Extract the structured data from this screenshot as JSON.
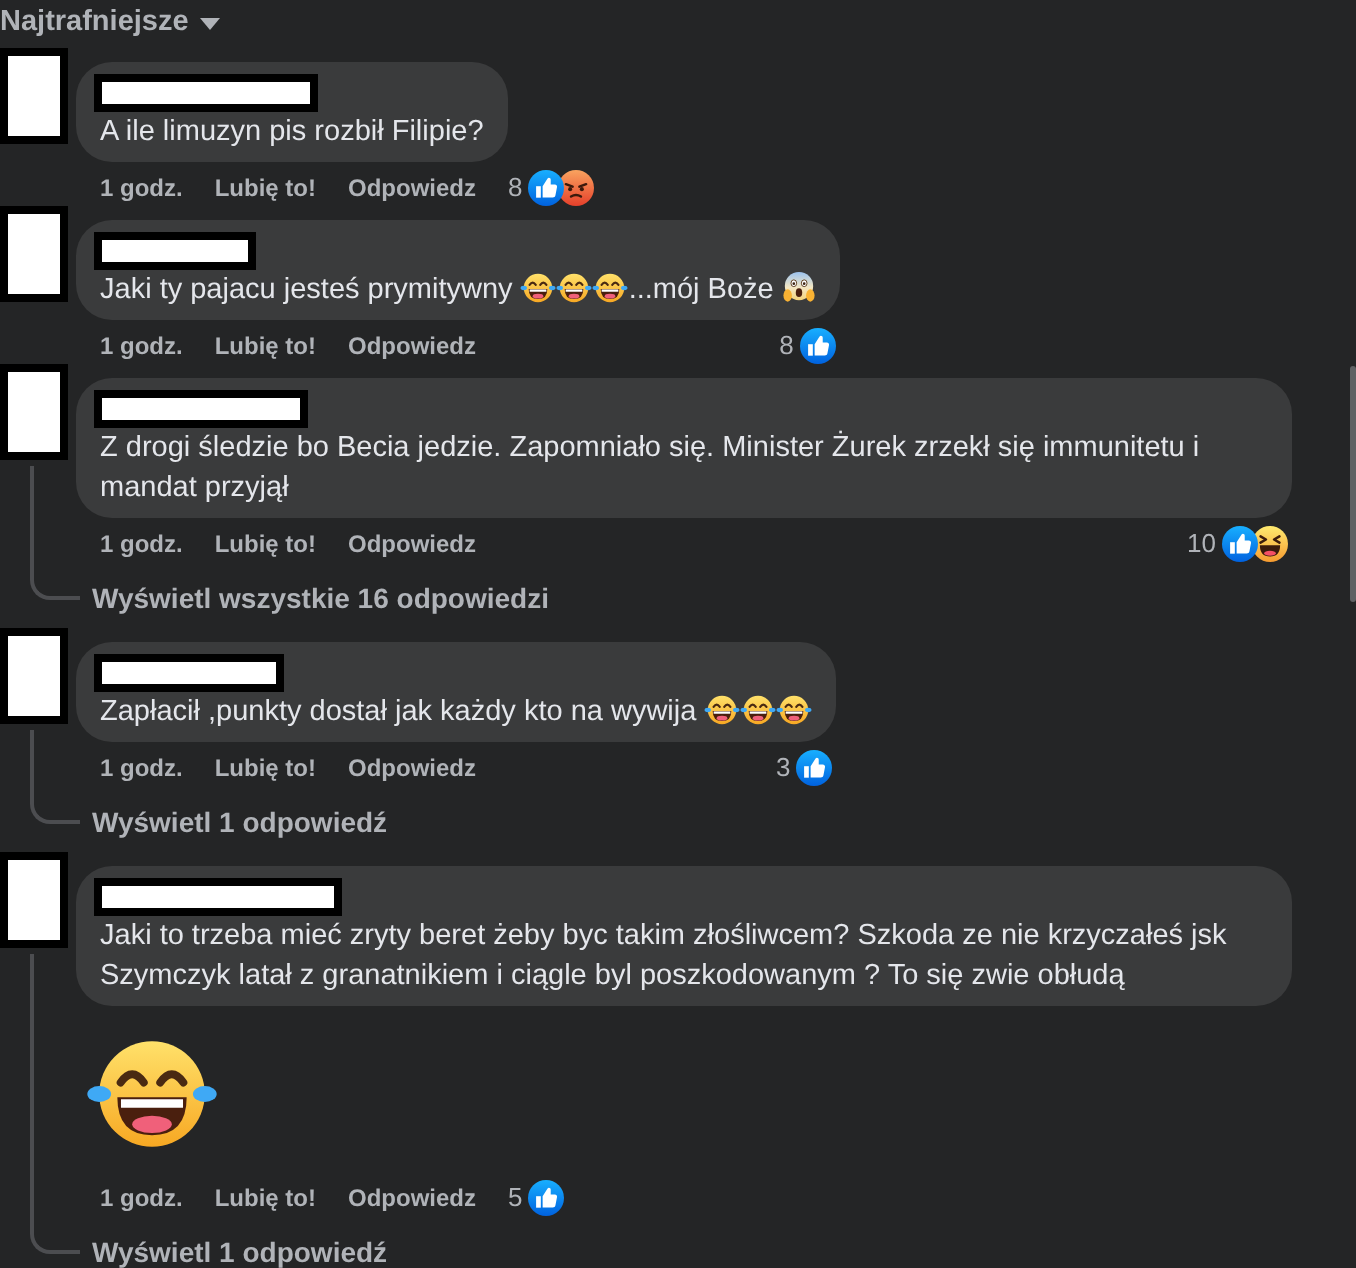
{
  "sort": {
    "label": "Najtrafniejsze"
  },
  "comments": [
    {
      "parts": [
        {
          "kind": "text",
          "text": "A ile limuzyn pis rozbił Filipie?"
        }
      ],
      "time": "1 godz.",
      "like": "Lubię to!",
      "reply": "Odpowiedz",
      "reactions": {
        "count": "8",
        "icons": [
          {
            "kind": "like"
          },
          {
            "kind": "angry"
          }
        ]
      }
    },
    {
      "parts": [
        {
          "kind": "text",
          "text": "Jaki ty pajacu jesteś prymitywny "
        },
        {
          "kind": "laugh"
        },
        {
          "kind": "laugh"
        },
        {
          "kind": "laugh"
        },
        {
          "kind": "text",
          "text": "...mój Boże "
        },
        {
          "kind": "scream"
        }
      ],
      "time": "1 godz.",
      "like": "Lubię to!",
      "reply": "Odpowiedz",
      "reactions": {
        "count": "8",
        "icons": [
          {
            "kind": "like"
          }
        ]
      }
    },
    {
      "parts": [
        {
          "kind": "text",
          "text": "Z drogi śledzie bo Becia jedzie. Zapomniało się. Minister Żurek zrzekł się immunitetu i mandat przyjął"
        }
      ],
      "time": "1 godz.",
      "like": "Lubię to!",
      "reply": "Odpowiedz",
      "reactions": {
        "count": "10",
        "icons": [
          {
            "kind": "like"
          },
          {
            "kind": "haha"
          }
        ]
      },
      "replies": {
        "label": "Wyświetl wszystkie 16 odpowiedzi"
      }
    },
    {
      "parts": [
        {
          "kind": "text",
          "text": "Zapłacił ,punkty dostał jak każdy kto na wywija "
        },
        {
          "kind": "laugh"
        },
        {
          "kind": "laugh"
        },
        {
          "kind": "laugh"
        }
      ],
      "time": "1 godz.",
      "like": "Lubię to!",
      "reply": "Odpowiedz",
      "reactions": {
        "count": "3",
        "icons": [
          {
            "kind": "like"
          }
        ]
      },
      "replies": {
        "label": "Wyświetl 1 odpowiedź"
      }
    },
    {
      "parts": [
        {
          "kind": "text",
          "text": "Jaki to trzeba mieć zryty beret żeby byc takim złośliwcem? Szkoda ze nie krzyczałeś jsk Szymczyk latał z granatnikiem i ciągle byl poszkodowanym ? To się zwie obłudą"
        }
      ],
      "attachment": {
        "kind": "laugh"
      },
      "time": "1 godz.",
      "like": "Lubię to!",
      "reply": "Odpowiedz",
      "reactions": {
        "count": "5",
        "icons": [
          {
            "kind": "like"
          }
        ]
      },
      "replies": {
        "label": "Wyświetl 1 odpowiedź"
      }
    }
  ]
}
